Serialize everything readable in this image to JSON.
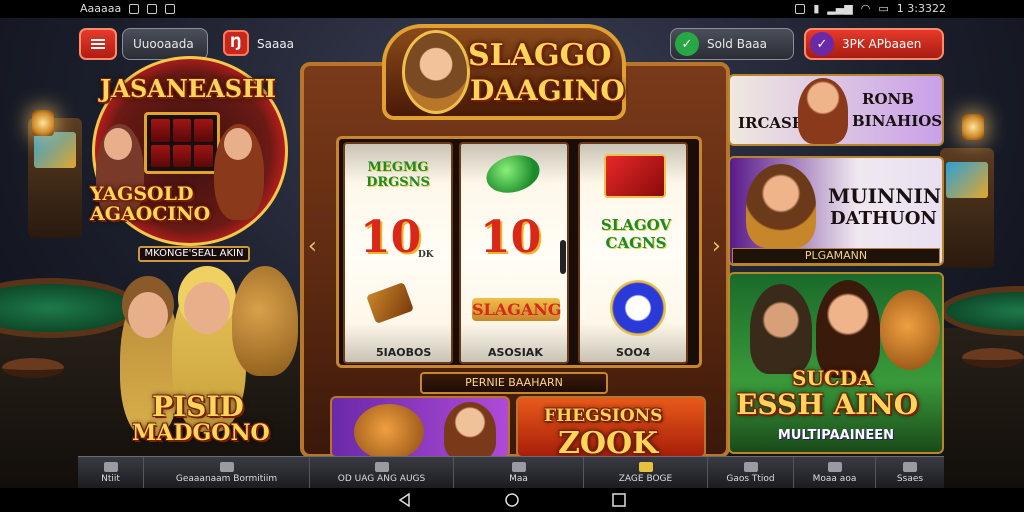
{
  "status_bar": {
    "app_name": "Aaaaaa",
    "time": "1 3:3322"
  },
  "top_bar": {
    "menu_label": "",
    "left_pill": "Uuooaada",
    "chip_label": "Ŋ",
    "chip_text": "Saaaa",
    "right_pill": "Sold Baaa",
    "right_pill_icon": "✓",
    "action_button": "3PK APbaaen",
    "action_button_icon": "✓"
  },
  "left_promo": {
    "title": "JASANEASHI",
    "wheel_text": "YAGSOLD AGAOCINO",
    "plate_text": "MKONGE'SEAL AKIN",
    "bottom_title_1": "PISID",
    "bottom_title_2": "MADGONO"
  },
  "cabinet": {
    "logo_line_1": "SLAGGO",
    "logo_line_2": "DAAGINO",
    "reel_1": {
      "top": "MEGMG DRGSNS",
      "middle": "10",
      "middle_suffix": "DK",
      "foot": "5IAOBOS"
    },
    "reel_2": {
      "middle": "10",
      "bottom": "SLAGANG",
      "foot": "ASOSIAK"
    },
    "reel_3": {
      "top": "SLAGOV CAGNS",
      "foot": "SOO4"
    },
    "banner": "PERNIE BAAHARN"
  },
  "bottom_tiles": {
    "tile_2_line_1": "FHEGSIONS",
    "tile_2_line_2": "ZOOK"
  },
  "right_cards": {
    "card_1": {
      "left": "IRCASRIM",
      "right_1": "RONB",
      "right_2": "BINAHIOS"
    },
    "card_2": {
      "title_1": "MUINNING",
      "title_2": "DATHUON",
      "label": "PLGAMANN"
    },
    "card_3": {
      "title_1": "SUCDA",
      "title_2": "ESSH AINO",
      "subtitle": "MULTIPAAINEEN"
    }
  },
  "bottom_nav": [
    {
      "label": "Ntiit",
      "icon": "home-icon"
    },
    {
      "label": "Geaaanaam Bormitiim",
      "icon": "card-icon"
    },
    {
      "label": "OD UAG ANG AUGS",
      "icon": "star-icon"
    },
    {
      "label": "Maa",
      "icon": "diamond-icon"
    },
    {
      "label": "ZAGE BOGE",
      "icon": "badge-icon"
    },
    {
      "label": "Gaos Ttiod",
      "icon": "gift-icon"
    },
    {
      "label": "Moaa aoa",
      "icon": "people-icon"
    },
    {
      "label": "Ssaes",
      "icon": "grid-icon"
    }
  ],
  "colors": {
    "accent_red": "#d02a1c",
    "gold": "#ffd65a",
    "wood": "#7a3a1a"
  }
}
